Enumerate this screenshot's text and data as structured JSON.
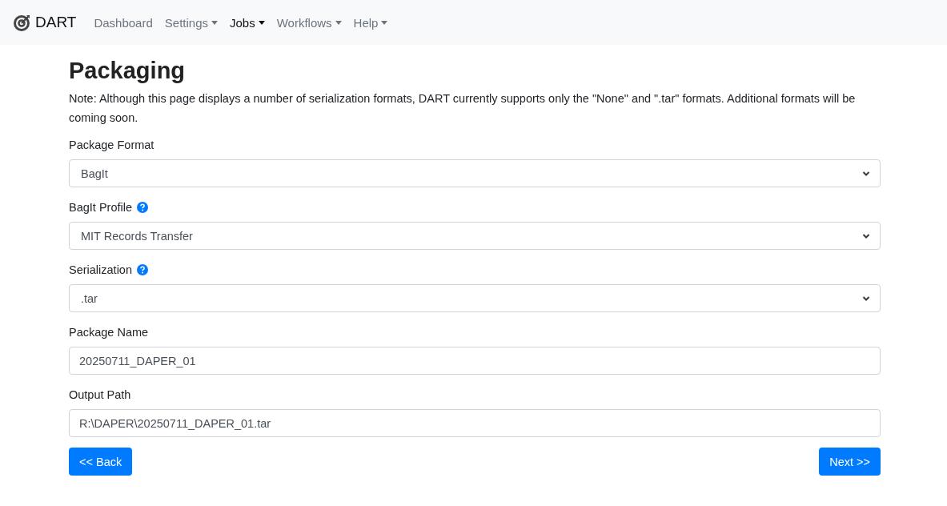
{
  "navbar": {
    "brand": "DART",
    "items": [
      {
        "label": "Dashboard",
        "dropdown": false,
        "selected": false
      },
      {
        "label": "Settings",
        "dropdown": true,
        "selected": false
      },
      {
        "label": "Jobs",
        "dropdown": true,
        "selected": true
      },
      {
        "label": "Workflows",
        "dropdown": true,
        "selected": false
      },
      {
        "label": "Help",
        "dropdown": true,
        "selected": false
      }
    ]
  },
  "page": {
    "title": "Packaging",
    "note": "Note: Although this page displays a number of serialization formats, DART currently supports only the \"None\" and \".tar\" formats. Additional formats will be coming soon."
  },
  "fields": [
    {
      "kind": "select",
      "label": "Package Format",
      "help": false,
      "value": "BagIt"
    },
    {
      "kind": "select",
      "label": "BagIt Profile",
      "help": true,
      "value": "MIT Records Transfer"
    },
    {
      "kind": "select",
      "label": "Serialization",
      "help": true,
      "value": ".tar"
    },
    {
      "kind": "text",
      "label": "Package Name",
      "help": false,
      "value": "20250711_DAPER_01"
    },
    {
      "kind": "text",
      "label": "Output Path",
      "help": false,
      "value": "R:\\DAPER\\20250711_DAPER_01.tar"
    }
  ],
  "buttons": {
    "back": "<< Back",
    "next": "Next >>"
  }
}
